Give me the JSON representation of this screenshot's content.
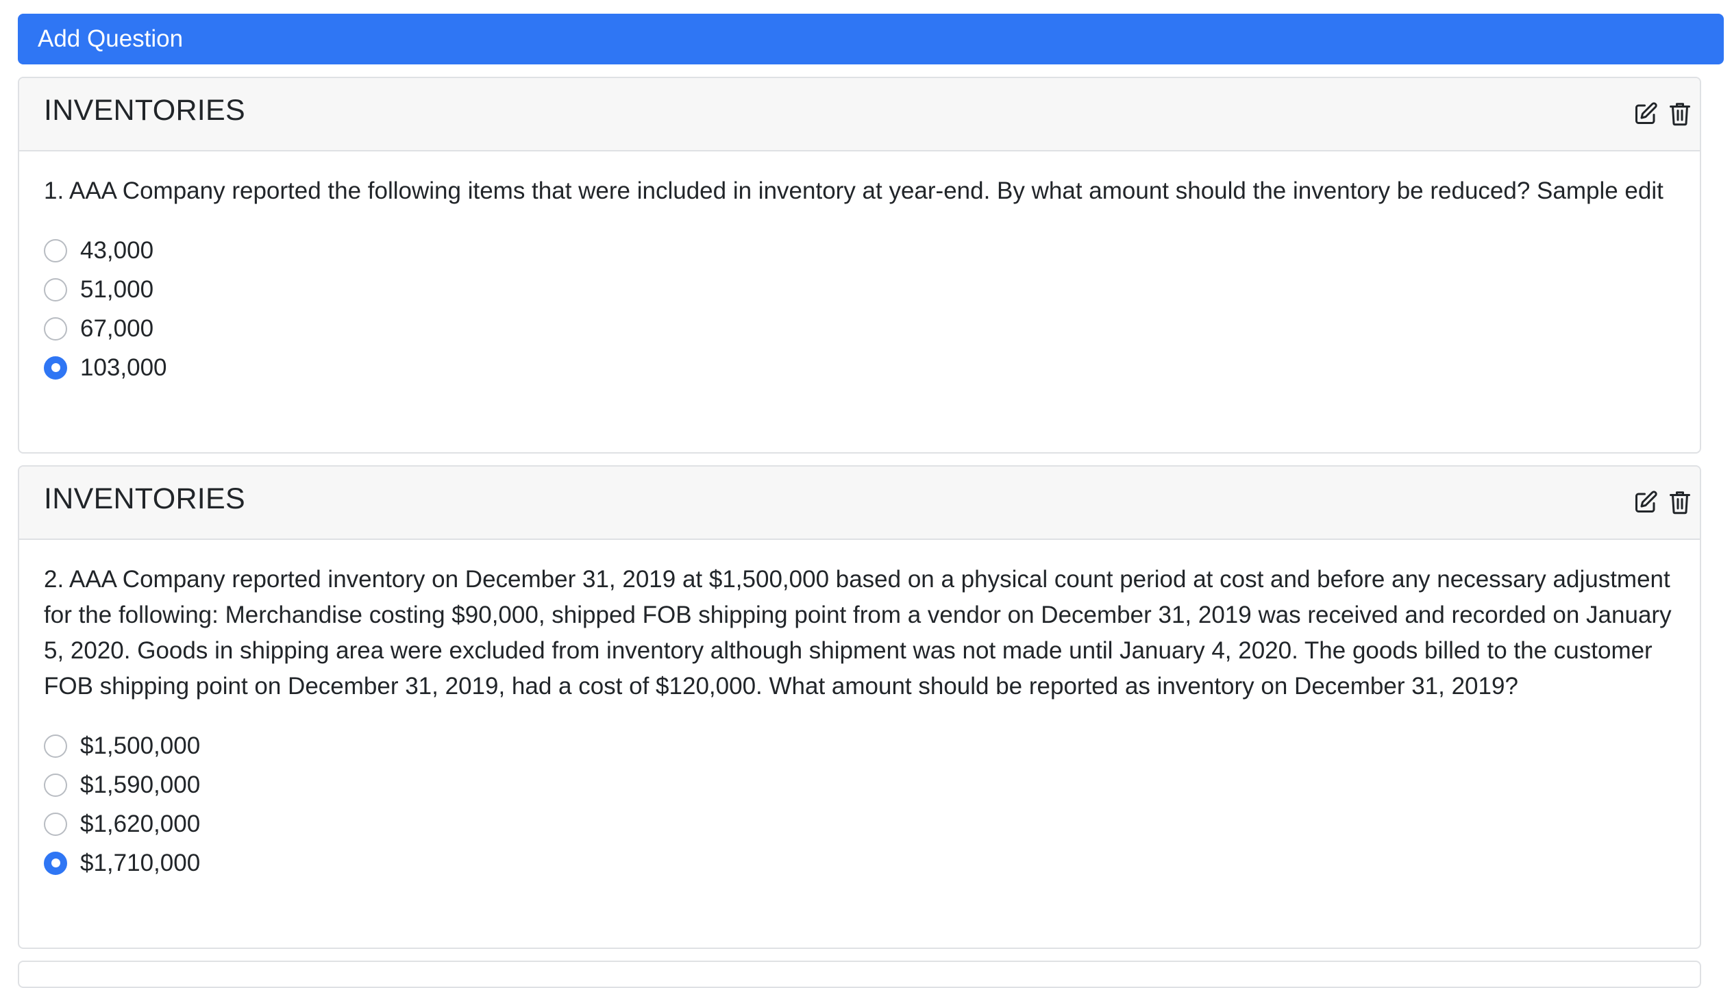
{
  "toolbar": {
    "add_question_label": "Add Question"
  },
  "colors": {
    "accent": "#2f76f4",
    "header_bg": "#f7f7f7",
    "border": "#dfe1e4",
    "text": "#212529"
  },
  "questions": [
    {
      "category": "INVENTORIES",
      "text": "1. AAA Company reported the following items that were included in inventory at year-end. By what amount should the inventory be reduced? Sample edit",
      "edit_icon": "edit-icon",
      "delete_icon": "trash-icon",
      "options": [
        {
          "label": "43,000",
          "selected": false
        },
        {
          "label": "51,000",
          "selected": false
        },
        {
          "label": "67,000",
          "selected": false
        },
        {
          "label": "103,000",
          "selected": true
        }
      ]
    },
    {
      "category": "INVENTORIES",
      "text": "2. AAA Company reported inventory on December 31, 2019 at $1,500,000 based on a physical count period at cost and before any necessary adjustment for the following: Merchandise costing $90,000, shipped FOB shipping point from a vendor on December 31, 2019 was received and recorded on January 5, 2020. Goods in shipping area were excluded from inventory although shipment was not made until January 4, 2020. The goods billed to the customer FOB shipping point on December 31, 2019, had a cost of $120,000. What amount should be reported as inventory on December 31, 2019?",
      "edit_icon": "edit-icon",
      "delete_icon": "trash-icon",
      "options": [
        {
          "label": "$1,500,000",
          "selected": false
        },
        {
          "label": "$1,590,000",
          "selected": false
        },
        {
          "label": "$1,620,000",
          "selected": false
        },
        {
          "label": "$1,710,000",
          "selected": true
        }
      ]
    }
  ]
}
